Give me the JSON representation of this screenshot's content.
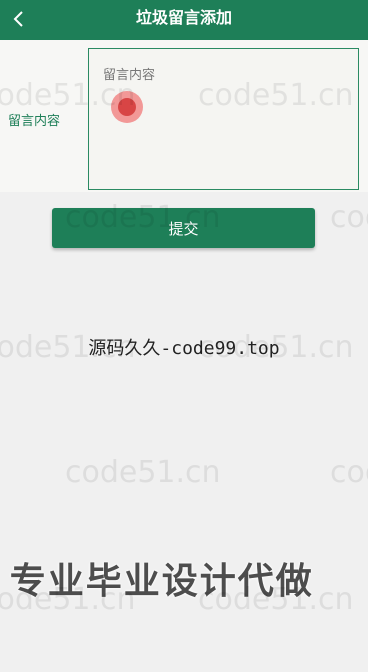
{
  "header": {
    "title": "垃圾留言添加",
    "back_icon": "chevron-left-icon"
  },
  "form": {
    "field_label": "留言内容",
    "textarea_placeholder": "留言内容",
    "textarea_value": ""
  },
  "actions": {
    "submit_label": "提交"
  },
  "overlay": {
    "caption": "源码久久-code99.top",
    "banner": "专业毕业设计代做",
    "banner_prefix": "|",
    "watermark": "code51.cn"
  },
  "colors": {
    "primary": "#1e7f58",
    "background": "#f0f0f0",
    "touch_indicator": "#d84545"
  }
}
